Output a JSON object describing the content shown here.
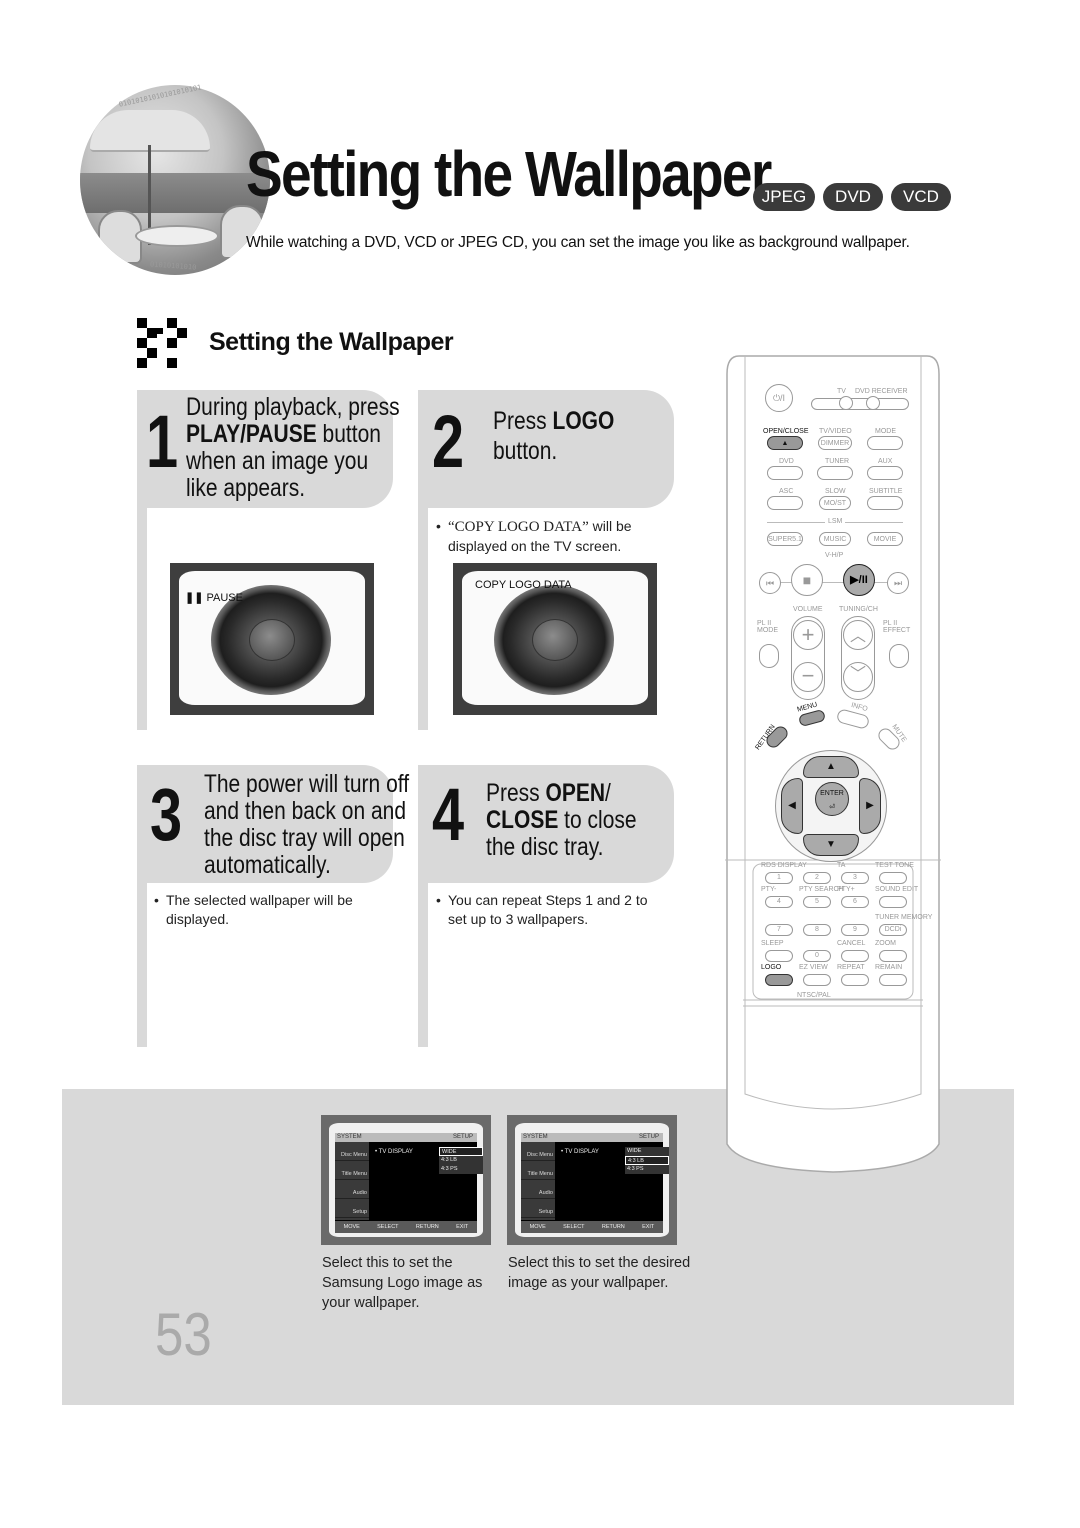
{
  "header": {
    "title": "Setting the Wallpaper",
    "badges": [
      "JPEG",
      "DVD",
      "VCD"
    ],
    "intro": "While watching a DVD, VCD or JPEG CD, you can set the image you like as background wallpaper."
  },
  "section": {
    "title": "Setting the Wallpaper"
  },
  "steps": [
    {
      "number": "1",
      "lines": [
        {
          "pre": "During playback, press",
          "bold": "",
          "post": ""
        },
        {
          "pre": "",
          "bold": "PLAY/PAUSE",
          "post": " button"
        },
        {
          "pre": "when an image you",
          "bold": "",
          "post": ""
        },
        {
          "pre": "like appears.",
          "bold": "",
          "post": ""
        }
      ],
      "screen_osd": "PAUSE"
    },
    {
      "number": "2",
      "lines": [
        {
          "pre": "Press ",
          "bold": "LOGO",
          "post": ""
        },
        {
          "pre": "button.",
          "bold": "",
          "post": ""
        }
      ],
      "note_quote": "“COPY LOGO DATA”",
      "note_rest_line1": " will be",
      "note_line2": "displayed on the TV screen.",
      "screen_osd": "COPY LOGO DATA"
    },
    {
      "number": "3",
      "lines": [
        {
          "pre": "The power will turn off",
          "bold": "",
          "post": ""
        },
        {
          "pre": "and then back on and",
          "bold": "",
          "post": ""
        },
        {
          "pre": "the disc tray will open",
          "bold": "",
          "post": ""
        },
        {
          "pre": "automatically.",
          "bold": "",
          "post": ""
        }
      ],
      "note_line1": "The selected wallpaper will be",
      "note_line2": "displayed."
    },
    {
      "number": "4",
      "lines": [
        {
          "pre": "Press ",
          "bold": "OPEN",
          "post": "/"
        },
        {
          "pre": "",
          "bold": "CLOSE",
          "post": " to close"
        },
        {
          "pre": "the disc tray.",
          "bold": "",
          "post": ""
        }
      ],
      "note_line1": "You can repeat Steps 1 and 2 to",
      "note_line2": "set up to 3 wallpapers."
    }
  ],
  "bullet": "•",
  "menu_screens": [
    {
      "header_right": "SETUP",
      "side_items": [
        "Disc Menu",
        "Title Menu",
        "Audio",
        "Setup"
      ],
      "label": "• TV DISPLAY",
      "options": [
        "WIDE",
        "4:3 LB",
        "4:3 PS"
      ],
      "selected": 0,
      "footer": [
        "MOVE",
        "SELECT",
        "RETURN",
        "EXIT"
      ],
      "caption": [
        "Select this to set the",
        "Samsung Logo image as",
        "your wallpaper."
      ]
    },
    {
      "header_right": "SETUP",
      "side_items": [
        "Disc Menu",
        "Title Menu",
        "Audio",
        "Setup"
      ],
      "label": "• TV DISPLAY",
      "options": [
        "WIDE",
        "4:3 LB",
        "4:3 PS"
      ],
      "selected": 1,
      "footer": [
        "MOVE",
        "SELECT",
        "RETURN",
        "EXIT"
      ],
      "caption": [
        "Select this to set the desired",
        "image as your wallpaper."
      ]
    }
  ],
  "page_number": "53",
  "remote": {
    "power_symbol": "⏻/I",
    "mode_labels": [
      "TV",
      "DVD RECEIVER"
    ],
    "row1": {
      "labels": [
        "OPEN/CLOSE",
        "TV/VIDEO",
        "MODE"
      ],
      "buttons": [
        "▲",
        "DIMMER",
        ""
      ]
    },
    "row2": {
      "labels": [
        "DVD",
        "TUNER",
        "AUX"
      ]
    },
    "row3": {
      "labels": [
        "ASC",
        "SLOW",
        "SUBTITLE"
      ],
      "buttons": [
        "",
        "MO/ST",
        ""
      ]
    },
    "lsm_label": "LSM",
    "row4": {
      "buttons": [
        "SUPER5.1",
        "MUSIC",
        "MOVIE"
      ]
    },
    "vhp_label": "V-H/P",
    "transport": [
      "⏮",
      "■",
      "▶/II",
      "⏭"
    ],
    "volume_label": "VOLUME",
    "tuning_label": "TUNING/CH",
    "pl_mode": [
      "PL II",
      "MODE"
    ],
    "pl_effect": [
      "PL II",
      "EFFECT"
    ],
    "vol_symbols": [
      "+",
      "−"
    ],
    "ch_symbols": [
      "︿",
      "﹀"
    ],
    "menu_label": "MENU",
    "info_label": "INFO",
    "return_label": "RETURN",
    "mute_label": "MUTE",
    "enter_label": "ENTER",
    "arrows": [
      "▲",
      "◀",
      "▶",
      "▼"
    ],
    "keypad": [
      {
        "label": "RDS DISPLAY",
        "key": "1"
      },
      {
        "label": "",
        "key": "2"
      },
      {
        "label": "TA",
        "key": "3"
      },
      {
        "label": "TEST TONE",
        "key": ""
      },
      {
        "label": "PTY-",
        "key": "4"
      },
      {
        "label": "PTY SEARCH",
        "key": "5"
      },
      {
        "label": "PTY+",
        "key": "6"
      },
      {
        "label": "SOUND EDIT",
        "key": ""
      },
      {
        "label": "",
        "key": "7"
      },
      {
        "label": "",
        "key": "8"
      },
      {
        "label": "",
        "key": "9"
      },
      {
        "label": "TUNER MEMORY",
        "key": "DCDi"
      },
      {
        "label": "SLEEP",
        "key": ""
      },
      {
        "label": "",
        "key": "0"
      },
      {
        "label": "CANCEL",
        "key": ""
      },
      {
        "label": "ZOOM",
        "key": ""
      },
      {
        "label": "LOGO",
        "key": ""
      },
      {
        "label": "EZ VIEW",
        "key": ""
      },
      {
        "label": "REPEAT",
        "key": ""
      },
      {
        "label": "REMAIN",
        "key": ""
      }
    ],
    "ntsc_label": "NTSC/PAL"
  }
}
